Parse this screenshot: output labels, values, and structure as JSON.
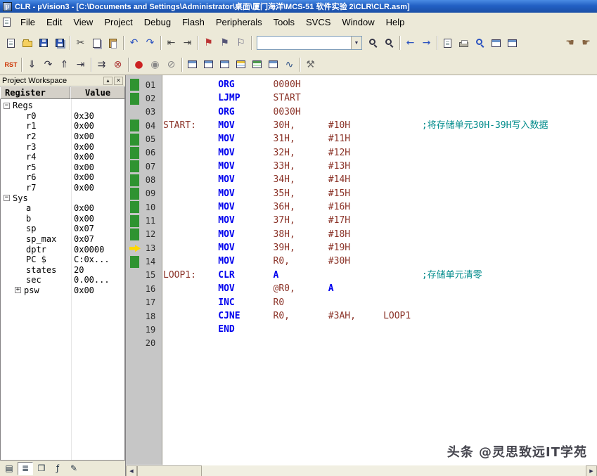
{
  "window": {
    "title": "CLR - µVision3 - [C:\\Documents and Settings\\Administrator\\桌面\\厦门海洋\\MCS-51 软件实验 2\\CLR\\CLR.asm]",
    "app_icon_label": "µ"
  },
  "menu": {
    "items": [
      "File",
      "Edit",
      "View",
      "Project",
      "Debug",
      "Flash",
      "Peripherals",
      "Tools",
      "SVCS",
      "Window",
      "Help"
    ]
  },
  "find_combo": {
    "value": "",
    "arrow": "▼"
  },
  "toolbar_main": [
    {
      "name": "new-file-icon",
      "shape": "page"
    },
    {
      "name": "open-file-icon",
      "shape": "folder"
    },
    {
      "name": "save-icon",
      "shape": "floppy"
    },
    {
      "name": "save-all-icon",
      "shape": "floppy2"
    },
    {
      "sep": true
    },
    {
      "name": "cut-icon",
      "glyph": "✂",
      "color": "#444444"
    },
    {
      "name": "copy-icon",
      "shape": "copy"
    },
    {
      "name": "paste-icon",
      "shape": "paste"
    },
    {
      "sep": true
    },
    {
      "name": "undo-icon",
      "glyph": "↶",
      "color": "#2a52c0"
    },
    {
      "name": "redo-icon",
      "glyph": "↷",
      "color": "#2a52c0"
    },
    {
      "sep": true
    },
    {
      "name": "indent-left-icon",
      "glyph": "⇤",
      "color": "#444444"
    },
    {
      "name": "indent-right-icon",
      "glyph": "⇥",
      "color": "#444444"
    },
    {
      "sep": true
    },
    {
      "name": "toggle-bookmark-icon",
      "glyph": "⚑",
      "color": "#bb3333"
    },
    {
      "name": "next-bookmark-icon",
      "glyph": "⚑",
      "color": "#555577"
    },
    {
      "name": "clear-bookmarks-icon",
      "glyph": "⚐",
      "color": "#555577"
    },
    {
      "sep": true
    },
    {
      "name": "find-combo",
      "combo": true
    },
    {
      "name": "find-in-files-icon",
      "shape": "mag"
    },
    {
      "name": "find-icon",
      "shape": "mag"
    },
    {
      "sep": true
    },
    {
      "name": "navigate-back-icon",
      "glyph": "←",
      "color": "#2a52c0"
    },
    {
      "name": "navigate-forward-icon",
      "glyph": "→",
      "color": "#2a52c0"
    },
    {
      "sep": true
    },
    {
      "name": "goto-line-icon",
      "shape": "page"
    },
    {
      "name": "print-icon",
      "shape": "printer"
    },
    {
      "name": "zoom-icon",
      "shape": "magblue"
    },
    {
      "name": "project-window-icon",
      "shape": "window"
    },
    {
      "name": "output-window-icon",
      "shape": "window"
    },
    {
      "spacer": true
    },
    {
      "name": "pan-hand-icon",
      "glyph": "☚",
      "color": "#886644"
    },
    {
      "name": "help-pointer-icon",
      "glyph": "☛",
      "color": "#886644"
    }
  ],
  "toolbar_debug": [
    {
      "name": "reset-button",
      "text": "RST"
    },
    {
      "sep": true
    },
    {
      "name": "step-into-icon",
      "glyph": "⇓",
      "color": "#333344"
    },
    {
      "name": "step-over-icon",
      "glyph": "↷",
      "color": "#333344"
    },
    {
      "name": "step-out-icon",
      "glyph": "⇑",
      "color": "#333344"
    },
    {
      "name": "run-to-cursor-icon",
      "glyph": "⇥",
      "color": "#333344"
    },
    {
      "sep": true
    },
    {
      "name": "run-icon",
      "glyph": "⇉",
      "color": "#333344"
    },
    {
      "name": "stop-icon",
      "glyph": "⊗",
      "color": "#aa3333"
    },
    {
      "sep": true
    },
    {
      "name": "breakpoint-toggle-icon",
      "glyph": "●",
      "color": "#cc2222"
    },
    {
      "name": "breakpoint-disable-icon",
      "glyph": "◉",
      "color": "#888888"
    },
    {
      "name": "breakpoint-kill-icon",
      "glyph": "⊘",
      "color": "#888888"
    },
    {
      "sep": true
    },
    {
      "name": "command-window-icon",
      "shape": "window"
    },
    {
      "name": "disassembly-window-icon",
      "shape": "window"
    },
    {
      "name": "symbol-window-icon",
      "shape": "window"
    },
    {
      "name": "watch-window-icon",
      "shape": "gridblue"
    },
    {
      "name": "memory-window-icon",
      "shape": "gridgreen"
    },
    {
      "name": "serial-window-icon",
      "shape": "window"
    },
    {
      "name": "analysis-window-icon",
      "glyph": "∿",
      "color": "#335588"
    },
    {
      "sep": true
    },
    {
      "name": "toolbox-icon",
      "glyph": "⚒",
      "color": "#666666"
    }
  ],
  "workspace": {
    "title": "Project Workspace",
    "buttons": [
      "▴",
      "✕"
    ],
    "columns": [
      "Register",
      "Value"
    ],
    "rows": [
      {
        "label": "Regs",
        "value": "",
        "level": 0,
        "expander": "minus"
      },
      {
        "label": "r0",
        "value": "0x30",
        "level": 1,
        "expander": null
      },
      {
        "label": "r1",
        "value": "0x00",
        "level": 1,
        "expander": null
      },
      {
        "label": "r2",
        "value": "0x00",
        "level": 1,
        "expander": null
      },
      {
        "label": "r3",
        "value": "0x00",
        "level": 1,
        "expander": null
      },
      {
        "label": "r4",
        "value": "0x00",
        "level": 1,
        "expander": null
      },
      {
        "label": "r5",
        "value": "0x00",
        "level": 1,
        "expander": null
      },
      {
        "label": "r6",
        "value": "0x00",
        "level": 1,
        "expander": null
      },
      {
        "label": "r7",
        "value": "0x00",
        "level": 1,
        "expander": null
      },
      {
        "label": "Sys",
        "value": "",
        "level": 0,
        "expander": "minus"
      },
      {
        "label": "a",
        "value": "0x00",
        "level": 1,
        "expander": null
      },
      {
        "label": "b",
        "value": "0x00",
        "level": 1,
        "expander": null
      },
      {
        "label": "sp",
        "value": "0x07",
        "level": 1,
        "expander": null
      },
      {
        "label": "sp_max",
        "value": "0x07",
        "level": 1,
        "expander": null
      },
      {
        "label": "dptr",
        "value": "0x0000",
        "level": 1,
        "expander": null
      },
      {
        "label": "PC $",
        "value": "C:0x...",
        "level": 1,
        "expander": null
      },
      {
        "label": "states",
        "value": "20",
        "level": 1,
        "expander": null
      },
      {
        "label": "sec",
        "value": "0.00...",
        "level": 1,
        "expander": null
      },
      {
        "label": "psw",
        "value": "0x00",
        "level": 1,
        "expander": "plus"
      }
    ],
    "tabs": [
      {
        "name": "workspace-tab-files",
        "glyph": "▤",
        "active": false
      },
      {
        "name": "workspace-tab-regs",
        "glyph": "≣",
        "active": true
      },
      {
        "name": "workspace-tab-books",
        "glyph": "❒",
        "active": false
      },
      {
        "name": "workspace-tab-functions",
        "glyph": "ƒ",
        "active": false
      },
      {
        "name": "workspace-tab-templates",
        "glyph": "✎",
        "active": false
      }
    ]
  },
  "editor": {
    "colors": {
      "keyword": "#0000ee",
      "operand": "#8b3328",
      "comment": "#008b8b",
      "register": "#0000ee",
      "marker_green": "#2f9331",
      "arrow_yellow": "#ffd800"
    },
    "scrollbar": {
      "left": "◀",
      "right": "▶"
    },
    "lines": [
      {
        "n": "01",
        "m": "g",
        "t": [
          [
            "ORG",
            "kw",
            10
          ],
          [
            "0000H",
            "op",
            20
          ]
        ]
      },
      {
        "n": "02",
        "m": "g",
        "t": [
          [
            "LJMP",
            "kw",
            10
          ],
          [
            "START",
            "op",
            20
          ]
        ]
      },
      {
        "n": "03",
        "m": "",
        "t": [
          [
            "ORG",
            "kw",
            10
          ],
          [
            "0030H",
            "op",
            20
          ]
        ]
      },
      {
        "n": "04",
        "m": "g",
        "t": [
          [
            "START:",
            "lbl",
            0
          ],
          [
            "MOV",
            "kw",
            10
          ],
          [
            "30H,",
            "op",
            20
          ],
          [
            "#10H",
            "op",
            30
          ],
          [
            ";将存储单元30H-39H写入数据",
            "cmt",
            47
          ]
        ]
      },
      {
        "n": "05",
        "m": "g",
        "t": [
          [
            "MOV",
            "kw",
            10
          ],
          [
            "31H,",
            "op",
            20
          ],
          [
            "#11H",
            "op",
            30
          ]
        ]
      },
      {
        "n": "06",
        "m": "g",
        "t": [
          [
            "MOV",
            "kw",
            10
          ],
          [
            "32H,",
            "op",
            20
          ],
          [
            "#12H",
            "op",
            30
          ]
        ]
      },
      {
        "n": "07",
        "m": "g",
        "t": [
          [
            "MOV",
            "kw",
            10
          ],
          [
            "33H,",
            "op",
            20
          ],
          [
            "#13H",
            "op",
            30
          ]
        ]
      },
      {
        "n": "08",
        "m": "g",
        "t": [
          [
            "MOV",
            "kw",
            10
          ],
          [
            "34H,",
            "op",
            20
          ],
          [
            "#14H",
            "op",
            30
          ]
        ]
      },
      {
        "n": "09",
        "m": "g",
        "t": [
          [
            "MOV",
            "kw",
            10
          ],
          [
            "35H,",
            "op",
            20
          ],
          [
            "#15H",
            "op",
            30
          ]
        ]
      },
      {
        "n": "10",
        "m": "g",
        "t": [
          [
            "MOV",
            "kw",
            10
          ],
          [
            "36H,",
            "op",
            20
          ],
          [
            "#16H",
            "op",
            30
          ]
        ]
      },
      {
        "n": "11",
        "m": "g",
        "t": [
          [
            "MOV",
            "kw",
            10
          ],
          [
            "37H,",
            "op",
            20
          ],
          [
            "#17H",
            "op",
            30
          ]
        ]
      },
      {
        "n": "12",
        "m": "g",
        "t": [
          [
            "MOV",
            "kw",
            10
          ],
          [
            "38H,",
            "op",
            20
          ],
          [
            "#18H",
            "op",
            30
          ]
        ]
      },
      {
        "n": "13",
        "m": "a",
        "t": [
          [
            "MOV",
            "kw",
            10
          ],
          [
            "39H,",
            "op",
            20
          ],
          [
            "#19H",
            "op",
            30
          ]
        ]
      },
      {
        "n": "14",
        "m": "g",
        "t": [
          [
            "MOV",
            "kw",
            10
          ],
          [
            "R0,",
            "op",
            20
          ],
          [
            "#30H",
            "op",
            30
          ]
        ]
      },
      {
        "n": "15",
        "m": "",
        "t": [
          [
            "LOOP1:",
            "lbl",
            0
          ],
          [
            "CLR",
            "kw",
            10
          ],
          [
            "A",
            "reg",
            20
          ],
          [
            ";存储单元清零",
            "cmt",
            47
          ]
        ]
      },
      {
        "n": "16",
        "m": "",
        "t": [
          [
            "MOV",
            "kw",
            10
          ],
          [
            "@R0,",
            "op",
            20
          ],
          [
            "A",
            "reg",
            30
          ]
        ]
      },
      {
        "n": "17",
        "m": "",
        "t": [
          [
            "INC",
            "kw",
            10
          ],
          [
            "R0",
            "op",
            20
          ]
        ]
      },
      {
        "n": "18",
        "m": "",
        "t": [
          [
            "CJNE",
            "kw",
            10
          ],
          [
            "R0,",
            "op",
            20
          ],
          [
            "#3AH,",
            "op",
            30
          ],
          [
            "LOOP1",
            "op",
            40
          ]
        ]
      },
      {
        "n": "19",
        "m": "",
        "t": [
          [
            "END",
            "kw",
            10
          ]
        ]
      },
      {
        "n": "20",
        "m": "",
        "t": []
      }
    ]
  },
  "watermark": "头条 @灵思致远IT学苑"
}
